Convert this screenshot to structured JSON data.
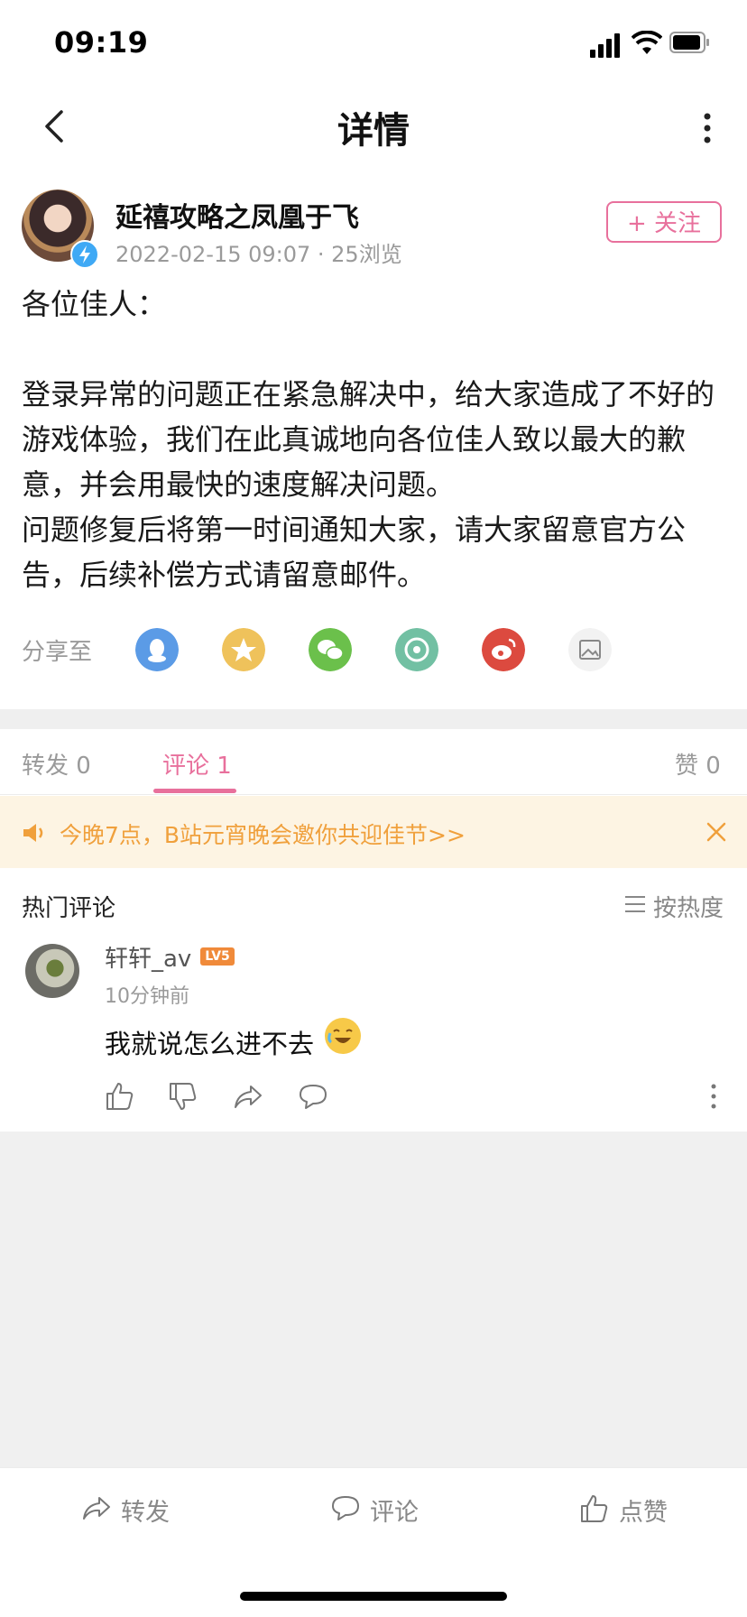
{
  "status_bar": {
    "time": "09:19"
  },
  "nav": {
    "title": "详情"
  },
  "author": {
    "name": "延禧攻略之凤凰于飞",
    "meta": "2022-02-15 09:07 · 25浏览",
    "follow_label": "+ 关注"
  },
  "article": {
    "text": "各位佳人：\n\n登录异常的问题正在紧急解决中，给大家造成了不好的游戏体验，我们在此真诚地向各位佳人致以最大的歉意，并会用最快的速度解决问题。\n问题修复后将第一时间通知大家，请大家留意官方公告，后续补偿方式请留意邮件。"
  },
  "share": {
    "label": "分享至",
    "targets": [
      {
        "icon": "qq-icon",
        "color": "#5b9be6"
      },
      {
        "icon": "qzone-icon",
        "color": "#efc25b"
      },
      {
        "icon": "wechat-icon",
        "color": "#6bc04b"
      },
      {
        "icon": "moments-icon",
        "color": "#72c0a3"
      },
      {
        "icon": "weibo-icon",
        "color": "#dc4a3f"
      },
      {
        "icon": "save-image-icon",
        "color": "#f2f2f2"
      }
    ]
  },
  "tabs": {
    "repost": "转发 0",
    "comment": "评论 1",
    "like": "赞 0"
  },
  "banner": {
    "text": "今晚7点，B站元宵晚会邀你共迎佳节>>"
  },
  "comments": {
    "section_title": "热门评论",
    "sort_label": "按热度",
    "items": [
      {
        "user": "轩轩_av",
        "level": "LV5",
        "time": "10分钟前",
        "text": "我就说怎么进不去"
      }
    ]
  },
  "bottom_bar": {
    "repost": "转发",
    "comment": "评论",
    "like": "点赞"
  },
  "colors": {
    "accent_pink": "#e8709c",
    "banner_orange": "#f0a03c"
  }
}
